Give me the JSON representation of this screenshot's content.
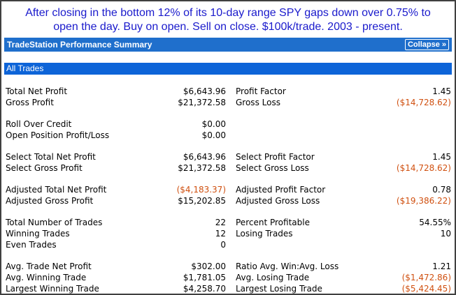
{
  "caption": {
    "line1": "After closing in the bottom 12% of its 10-day range SPY gaps down over 0.75% to",
    "line2": "open the day.  Buy on open. Sell on close. $100k/trade. 2003 - present."
  },
  "header": {
    "title": "TradeStation Performance Summary",
    "collapse_label": "Collapse »"
  },
  "section": {
    "title": "All Trades"
  },
  "colors": {
    "header_bg": "#1f6fcc",
    "section_bg": "#0d64d8",
    "negative": "#d05010",
    "caption": "#1a1acc"
  },
  "rows": [
    {
      "l1": "Total Net Profit",
      "v1": "$6,643.96",
      "l2": "Profit Factor",
      "v2": "1.45"
    },
    {
      "l1": "Gross Profit",
      "v1": "$21,372.58",
      "l2": "Gross Loss",
      "v2": "($14,728.62)"
    },
    {
      "l1": "Roll Over Credit",
      "v1": "$0.00",
      "l2": "",
      "v2": ""
    },
    {
      "l1": "Open Position Profit/Loss",
      "v1": "$0.00",
      "l2": "",
      "v2": ""
    },
    {
      "l1": "Select Total Net Profit",
      "v1": "$6,643.96",
      "l2": "Select Profit Factor",
      "v2": "1.45"
    },
    {
      "l1": "Select Gross Profit",
      "v1": "$21,372.58",
      "l2": "Select Gross Loss",
      "v2": "($14,728.62)"
    },
    {
      "l1": "Adjusted Total Net Profit",
      "v1": "($4,183.37)",
      "l2": "Adjusted Profit Factor",
      "v2": "0.78"
    },
    {
      "l1": "Adjusted Gross Profit",
      "v1": "$15,202.85",
      "l2": "Adjusted Gross Loss",
      "v2": "($19,386.22)"
    },
    {
      "l1": "Total Number of Trades",
      "v1": "22",
      "l2": "Percent Profitable",
      "v2": "54.55%"
    },
    {
      "l1": "Winning Trades",
      "v1": "12",
      "l2": "Losing Trades",
      "v2": "10"
    },
    {
      "l1": "Even Trades",
      "v1": "0",
      "l2": "",
      "v2": ""
    },
    {
      "l1": "Avg. Trade Net Profit",
      "v1": "$302.00",
      "l2": "Ratio Avg. Win:Avg. Loss",
      "v2": "1.21"
    },
    {
      "l1": "Avg. Winning Trade",
      "v1": "$1,781.05",
      "l2": "Avg. Losing Trade",
      "v2": "($1,472.86)"
    },
    {
      "l1": "Largest Winning Trade",
      "v1": "$4,258.70",
      "l2": "Largest Losing Trade",
      "v2": "($5,424.45)"
    }
  ]
}
